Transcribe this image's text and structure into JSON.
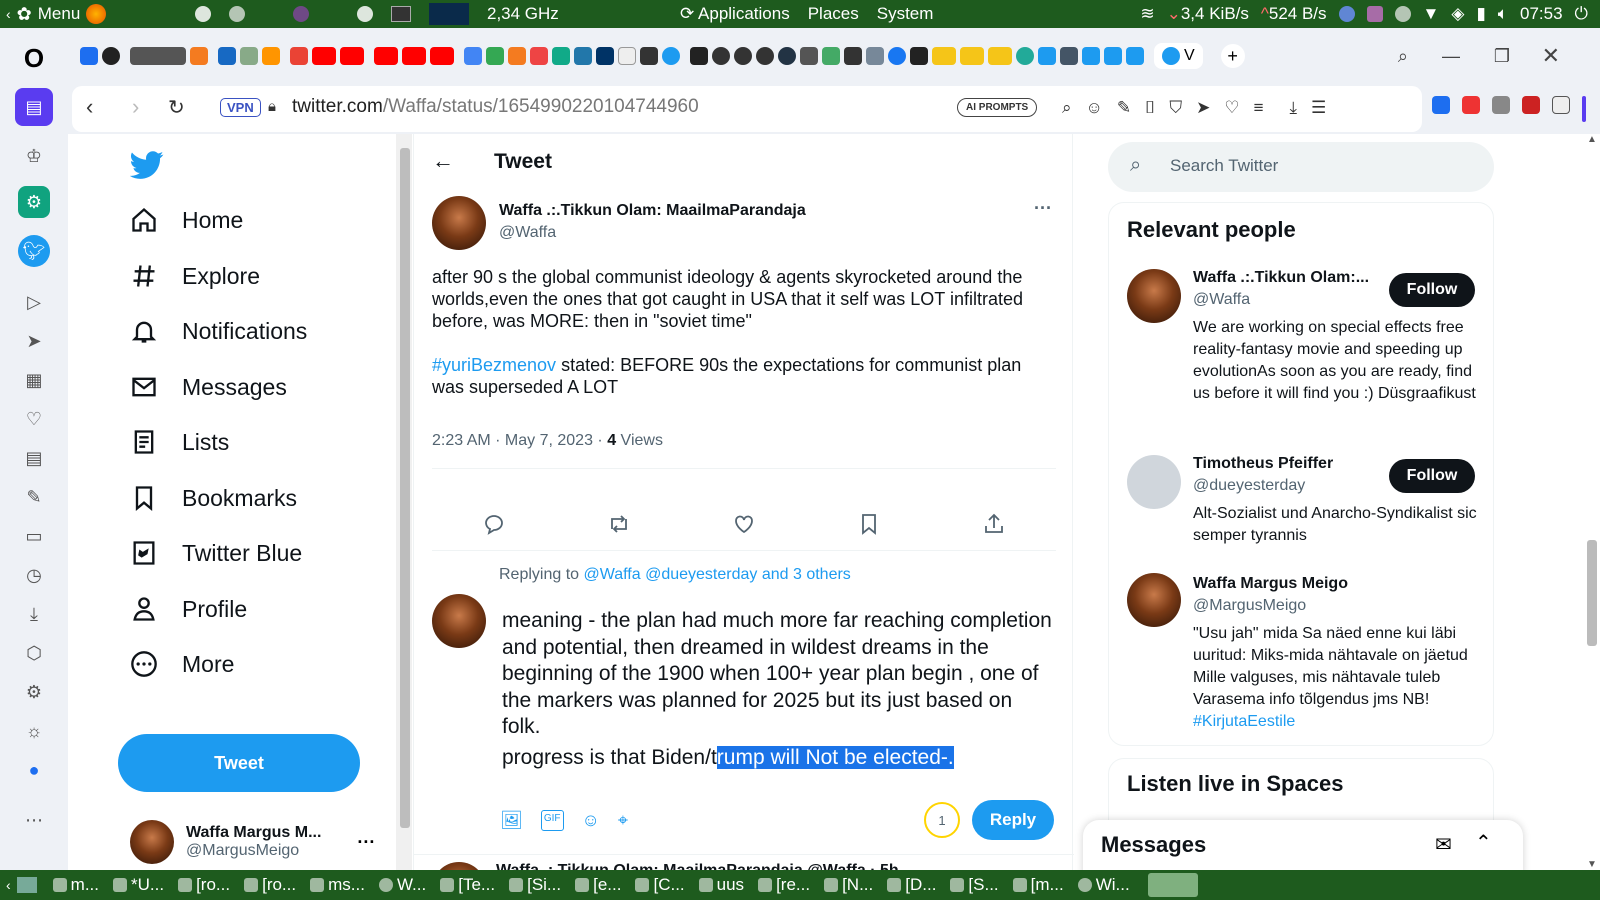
{
  "os_panel": {
    "menu_label": "Menu",
    "cpu_freq": "2,34 GHz",
    "menus": [
      "Applications",
      "Places",
      "System"
    ],
    "net_down": "3,4 KiB/s",
    "net_up": "524 B/s",
    "clock": "07:53"
  },
  "browser": {
    "vpn_label": "VPN",
    "url_host": "twitter.com",
    "url_path": "/Waffa/status/1654990220104744960",
    "ai_prompts_label": "AI PROMPTS",
    "tab_current_letter": "V"
  },
  "left_nav": {
    "items": [
      {
        "label": "Home",
        "icon": "home-icon"
      },
      {
        "label": "Explore",
        "icon": "hashtag-icon"
      },
      {
        "label": "Notifications",
        "icon": "bell-icon"
      },
      {
        "label": "Messages",
        "icon": "mail-icon"
      },
      {
        "label": "Lists",
        "icon": "list-icon"
      },
      {
        "label": "Bookmarks",
        "icon": "bookmark-icon"
      },
      {
        "label": "Twitter Blue",
        "icon": "twitter-blue-icon"
      },
      {
        "label": "Profile",
        "icon": "person-icon"
      },
      {
        "label": "More",
        "icon": "more-circle-icon"
      }
    ],
    "tweet_button": "Tweet",
    "account_name": "Waffa Margus M...",
    "account_handle": "@MargusMeigo"
  },
  "main": {
    "header_title": "Tweet",
    "tweet": {
      "author_name": "Waffa .:.Tikkun Olam: MaailmaParandaja",
      "author_handle": "@Waffa",
      "text_1": "after 90 s the global communist ideology & agents skyrocketed around the worlds,even the ones that got caught in USA that it self was LOT infiltrated before, was MORE: then in \"soviet time\"",
      "hashtag": "#yuriBezmenov",
      "text_2": " stated: BEFORE 90s the expectations for communist plan was superseded A LOT",
      "time": "2:23 AM · May 7, 2023 · ",
      "views_count": "4",
      "views_label": " Views"
    },
    "reply": {
      "replying_prefix": "Replying to ",
      "replying_targets": "@Waffa @dueyesterday and 3 others",
      "draft_text": "meaning - the plan had much more far reaching completion and potential, then dreamed in wildest dreams in the beginning of the 1900 when 100+ year plan begin , one of the markers was planned for 2025 but its just based on folk.",
      "draft_line2_plain": "progress is that Biden/t",
      "draft_line2_selected": "rump will Not be elected-.",
      "char_counter": "1",
      "reply_button": "Reply"
    },
    "next_tweet_peek": "Waffa .:.Tikkun Olam: MaailmaParandaja @Waffa · 5h"
  },
  "right": {
    "search_placeholder": "Search Twitter",
    "relevant_title": "Relevant people",
    "people": [
      {
        "name": "Waffa .:.Tikkun Olam:...",
        "handle": "@Waffa",
        "bio": "We are working on special effects free reality-fantasy movie and speeding up evolutionAs soon as you are ready, find us before it will find you :) Düsgraafikust",
        "follow": "Follow"
      },
      {
        "name": "Timotheus Pfeiffer",
        "handle": "@dueyesterday",
        "bio": "Alt-Sozialist und Anarcho-Syndikalist sic semper tyrannis",
        "follow": "Follow"
      },
      {
        "name": "Waffa Margus Meigo",
        "handle": "@MargusMeigo",
        "bio": "\"Usu jah\" mida Sa näed enne kui läbi uuritud: Miks-mida nähtavale on jäetud Mille valguses, mis nähtavale tuleb Varasema info tõlgendus jms NB! ",
        "bio_hashtag": "#KirjutaEestile",
        "follow": ""
      }
    ],
    "spaces_title": "Listen live in Spaces",
    "messages_title": "Messages"
  },
  "taskbar": {
    "tasks": [
      "m...",
      "*U...",
      "[ro...",
      "[ro...",
      "ms...",
      "W...",
      "[Te...",
      "[Si...",
      "[e...",
      "[C...",
      "uus",
      "[re...",
      "[N...",
      "[D...",
      "[S...",
      "[m...",
      "Wi..."
    ]
  },
  "colors": {
    "twitter_blue": "#1d9bf0",
    "os_panel": "#1e5b1e",
    "selection": "#1a73e8"
  }
}
